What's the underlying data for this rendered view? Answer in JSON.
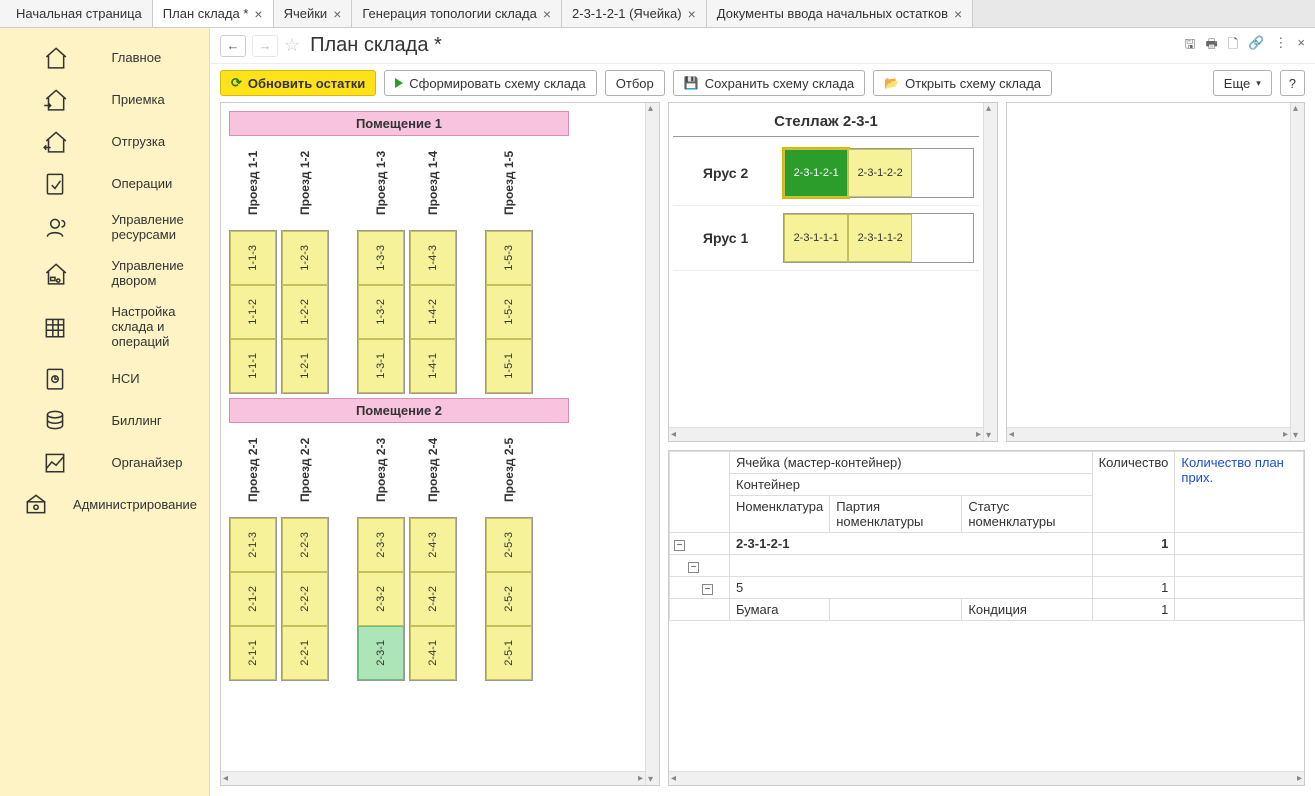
{
  "tabs": [
    {
      "label": "Начальная страница",
      "closable": false,
      "home": true
    },
    {
      "label": "План склада *",
      "closable": true,
      "active": true
    },
    {
      "label": "Ячейки",
      "closable": true
    },
    {
      "label": "Генерация топологии склада",
      "closable": true
    },
    {
      "label": "2-3-1-2-1 (Ячейка)",
      "closable": true
    },
    {
      "label": "Документы ввода начальных остатков",
      "closable": true
    }
  ],
  "sidebar": [
    {
      "id": "main",
      "label": "Главное"
    },
    {
      "id": "priemka",
      "label": "Приемка"
    },
    {
      "id": "otgruzka",
      "label": "Отгрузка"
    },
    {
      "id": "oper",
      "label": "Операции"
    },
    {
      "id": "resources",
      "label": "Управление ресурсами"
    },
    {
      "id": "yard",
      "label": "Управление двором"
    },
    {
      "id": "settings",
      "label": "Настройка склада и операций"
    },
    {
      "id": "nsi",
      "label": "НСИ"
    },
    {
      "id": "billing",
      "label": "Биллинг"
    },
    {
      "id": "organizer",
      "label": "Органайзер"
    },
    {
      "id": "admin",
      "label": "Администрирование"
    }
  ],
  "page_title": "План склада *",
  "toolbar": {
    "refresh": "Обновить остатки",
    "form_scheme": "Сформировать схему склада",
    "filter": "Отбор",
    "save_scheme": "Сохранить схему склада",
    "open_scheme": "Открыть схему склада",
    "more": "Еще",
    "help": "?"
  },
  "rooms": [
    {
      "title": "Помещение 1",
      "aisle_groups": [
        {
          "aisles": [
            {
              "label": "Проезд 1-1",
              "cells": [
                "1-1-3",
                "1-1-2",
                "1-1-1"
              ]
            },
            {
              "label": "Проезд 1-2",
              "cells": [
                "1-2-3",
                "1-2-2",
                "1-2-1"
              ]
            }
          ]
        },
        {
          "aisles": [
            {
              "label": "Проезд 1-3",
              "cells": [
                "1-3-3",
                "1-3-2",
                "1-3-1"
              ]
            },
            {
              "label": "Проезд 1-4",
              "cells": [
                "1-4-3",
                "1-4-2",
                "1-4-1"
              ]
            }
          ]
        },
        {
          "aisles": [
            {
              "label": "Проезд 1-5",
              "cells": [
                "1-5-3",
                "1-5-2",
                "1-5-1"
              ]
            }
          ]
        }
      ]
    },
    {
      "title": "Помещение 2",
      "aisle_groups": [
        {
          "aisles": [
            {
              "label": "Проезд 2-1",
              "cells": [
                "2-1-3",
                "2-1-2",
                "2-1-1"
              ]
            },
            {
              "label": "Проезд 2-2",
              "cells": [
                "2-2-3",
                "2-2-2",
                "2-2-1"
              ]
            }
          ]
        },
        {
          "aisles": [
            {
              "label": "Проезд 2-3",
              "cells": [
                "2-3-3",
                "2-3-2",
                "2-3-1"
              ],
              "green_idx": 2
            },
            {
              "label": "Проезд 2-4",
              "cells": [
                "2-4-3",
                "2-4-2",
                "2-4-1"
              ]
            }
          ]
        },
        {
          "aisles": [
            {
              "label": "Проезд 2-5",
              "cells": [
                "2-5-3",
                "2-5-2",
                "2-5-1"
              ]
            }
          ]
        }
      ]
    }
  ],
  "rack_panel": {
    "title": "Стеллаж 2-3-1",
    "tiers": [
      {
        "label": "Ярус 2",
        "cells": [
          "2-3-1-2-1",
          "2-3-1-2-2"
        ],
        "selected": 0
      },
      {
        "label": "Ярус 1",
        "cells": [
          "2-3-1-1-1",
          "2-3-1-1-2"
        ]
      }
    ]
  },
  "detail_table": {
    "headers": {
      "cell": "Ячейка (мастер-контейнер)",
      "qty": "Количество",
      "qty_plan": "Количество план прих.",
      "container": "Контейнер",
      "nomen": "Номенклатура",
      "party": "Партия номенклатуры",
      "status": "Статус номенклатуры"
    },
    "rows": [
      {
        "indent": 0,
        "toggle": "−",
        "cell": "2-3-1-2-1",
        "qty": "1",
        "bold": true
      },
      {
        "indent": 1,
        "toggle": "−",
        "cell": "",
        "qty": ""
      },
      {
        "indent": 2,
        "toggle": "−",
        "cell": "5",
        "qty": "1"
      },
      {
        "indent": 3,
        "nomen": "Бумага",
        "status": "Кондиция",
        "qty": "1"
      }
    ]
  }
}
